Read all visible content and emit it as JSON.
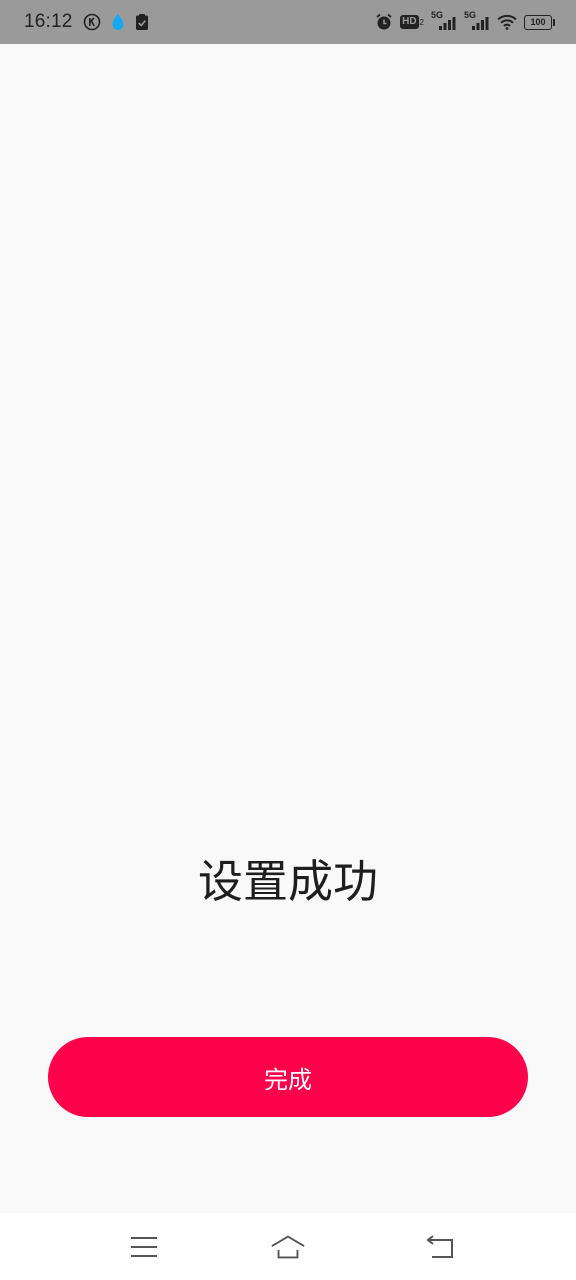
{
  "status_bar": {
    "time": "16:12",
    "hd_label": "HD",
    "hd_sub": "2",
    "signal_1_label": "5G",
    "signal_2_label": "5G",
    "battery_level": "100",
    "icons": [
      "k-circle-icon",
      "droplet-icon",
      "clipboard-check-icon",
      "alarm-icon",
      "hd-icon",
      "signal-icon",
      "signal-icon",
      "wifi-icon",
      "battery-icon"
    ]
  },
  "main": {
    "title": "设置成功",
    "done_button_label": "完成",
    "accent_color": "#ff004b"
  },
  "nav_bar": {
    "icons": [
      "menu-icon",
      "home-icon",
      "back-icon"
    ]
  }
}
